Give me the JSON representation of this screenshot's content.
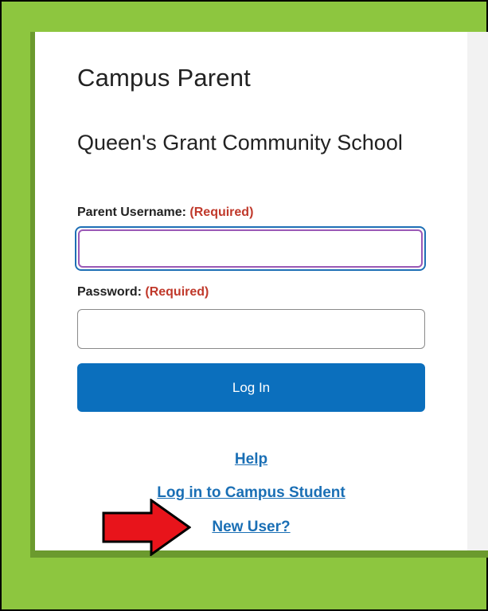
{
  "app": {
    "title": "Campus Parent",
    "school": "Queen's Grant Community School"
  },
  "form": {
    "username_label": "Parent Username:",
    "username_required": "(Required)",
    "username_value": "",
    "password_label": "Password:",
    "password_required": "(Required)",
    "password_value": "",
    "login_label": "Log In"
  },
  "links": {
    "help": "Help",
    "student": "Log in to Campus Student",
    "new_user": "New User?"
  },
  "colors": {
    "background_green": "#8dc63f",
    "button_blue": "#0b6fbd",
    "link_blue": "#1a6fb5",
    "required_red": "#c0392b",
    "arrow_red": "#e8141b"
  },
  "annotations": {
    "arrow_icon": "red-arrow-right-icon"
  }
}
